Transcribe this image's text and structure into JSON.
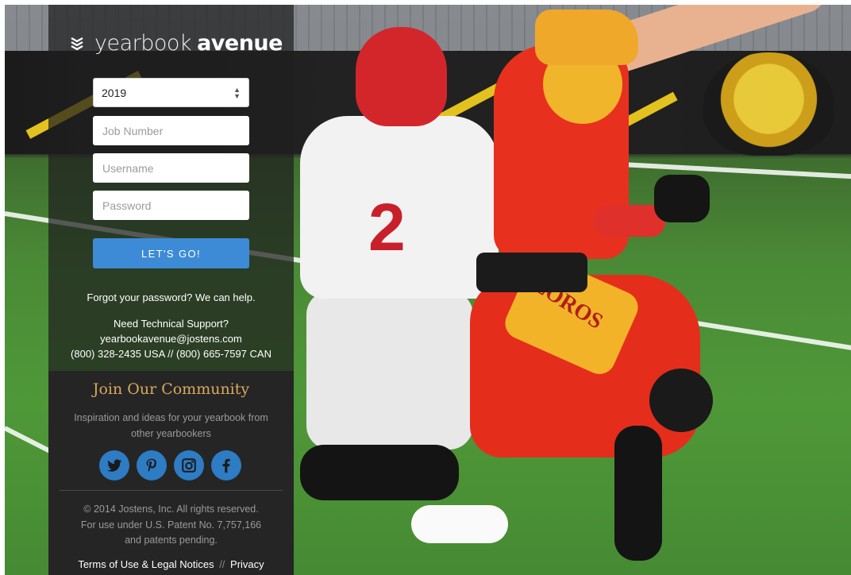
{
  "brand": {
    "name_light": "yearbook",
    "name_bold": "avenue",
    "icon": "chevron-stack-icon"
  },
  "login": {
    "year_value": "2019",
    "job_number_placeholder": "Job Number",
    "username_placeholder": "Username",
    "password_placeholder": "Password",
    "submit_label": "LET'S GO!",
    "forgot_text": "Forgot your password? We can help."
  },
  "support": {
    "heading": "Need Technical Support?",
    "email": "yearbookavenue@jostens.com",
    "phones": "(800) 328-2435 USA // (800) 665-7597 CAN"
  },
  "community": {
    "title": "Join Our Community",
    "description": "Inspiration and ideas for your yearbook from other yearbookers",
    "social_icons": [
      "twitter-icon",
      "pinterest-icon",
      "instagram-icon",
      "facebook-icon"
    ]
  },
  "footer": {
    "copyright_line1": "© 2014 Jostens, Inc. All rights reserved.",
    "copyright_line2": "For use under U.S. Patent No. 7,757,166",
    "copyright_line3": "and patents pending.",
    "terms_label": "Terms of Use & Legal Notices",
    "separator": "//",
    "privacy_label": "Privacy"
  },
  "background": {
    "jersey_number": "2",
    "pants_text": "LOROS"
  },
  "colors": {
    "accent_button": "#3d8bd6",
    "community_title": "#d9a95b",
    "social_circle": "#2d7cc4"
  }
}
